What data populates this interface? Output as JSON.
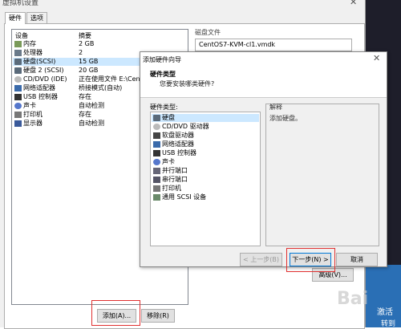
{
  "main_dialog": {
    "title": "虚拟机设置",
    "tabs": [
      "硬件",
      "选项"
    ],
    "device_header": "设备",
    "summary_header": "摘要",
    "devices": [
      {
        "name": "内存",
        "value": "2 GB",
        "icon": "memory-icon"
      },
      {
        "name": "处理器",
        "value": "2",
        "icon": "cpu-icon"
      },
      {
        "name": "硬盘(SCSI)",
        "value": "15 GB",
        "icon": "hard-disk-icon",
        "selected": true
      },
      {
        "name": "硬盘 2 (SCSI)",
        "value": "20 GB",
        "icon": "hard-disk-icon"
      },
      {
        "name": "CD/DVD (IDE)",
        "value": "正在使用文件 E:\\CentC",
        "icon": "cd-dvd-icon"
      },
      {
        "name": "网络适配器",
        "value": "桥接模式(自动)",
        "icon": "network-icon"
      },
      {
        "name": "USB 控制器",
        "value": "存在",
        "icon": "usb-icon"
      },
      {
        "name": "声卡",
        "value": "自动检测",
        "icon": "sound-icon"
      },
      {
        "name": "打印机",
        "value": "存在",
        "icon": "printer-icon"
      },
      {
        "name": "显示器",
        "value": "自动检测",
        "icon": "display-icon"
      }
    ],
    "disk_file_label": "磁盘文件",
    "disk_file_value": "CentOS7-KVM-cl1.vmdk",
    "add_button": "添加(A)...",
    "remove_button": "移除(R)",
    "advanced_button": "高级(V)..."
  },
  "wizard": {
    "title": "添加硬件向导",
    "heading": "硬件类型",
    "subheading": "您要安装哪类硬件?",
    "type_label": "硬件类型:",
    "types": [
      {
        "name": "硬盘",
        "icon": "hard-disk-icon",
        "selected": true
      },
      {
        "name": "CD/DVD 驱动器",
        "icon": "cd-dvd-icon"
      },
      {
        "name": "软盘驱动器",
        "icon": "floppy-icon"
      },
      {
        "name": "网络适配器",
        "icon": "network-icon"
      },
      {
        "name": "USB 控制器",
        "icon": "usb-icon"
      },
      {
        "name": "声卡",
        "icon": "sound-icon"
      },
      {
        "name": "并行端口",
        "icon": "parallel-port-icon"
      },
      {
        "name": "串行端口",
        "icon": "serial-port-icon"
      },
      {
        "name": "打印机",
        "icon": "printer-icon"
      },
      {
        "name": "通用 SCSI 设备",
        "icon": "scsi-icon"
      }
    ],
    "explanation_label": "解释",
    "explanation_text": "添加硬盘。",
    "back_button": "< 上一步(B)",
    "next_button": "下一步(N) >",
    "cancel_button": "取消"
  },
  "desktop": {
    "text1": "激活",
    "text2": "转到"
  },
  "watermark": "Bai"
}
